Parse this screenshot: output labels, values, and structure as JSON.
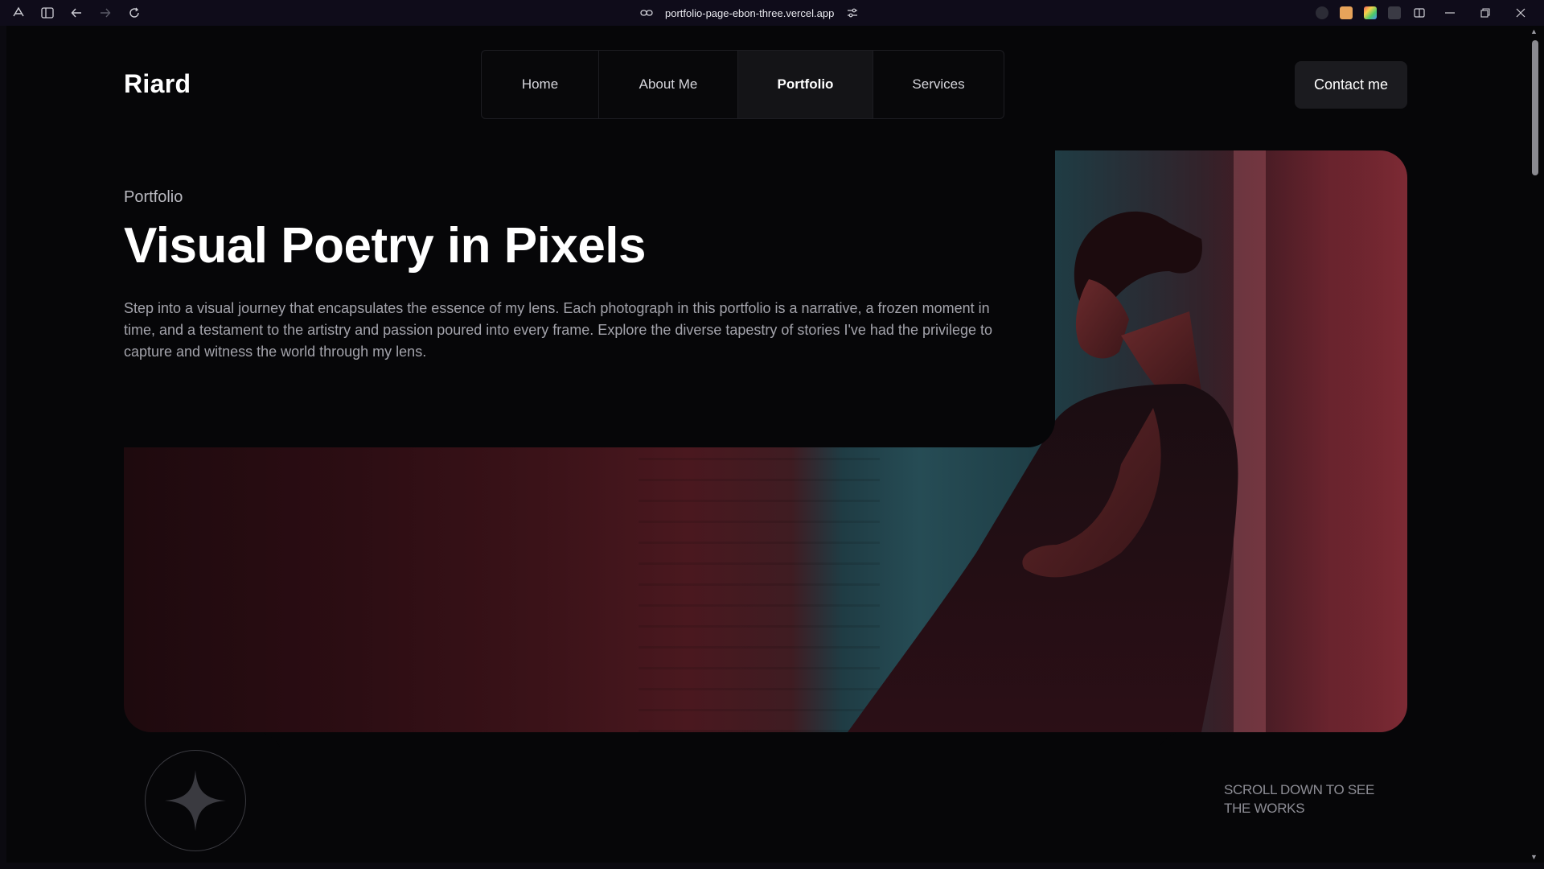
{
  "browser": {
    "url": "portfolio-page-ebon-three.vercel.app"
  },
  "site": {
    "logo": "Riard",
    "nav": [
      {
        "label": "Home"
      },
      {
        "label": "About Me"
      },
      {
        "label": "Portfolio",
        "active": true
      },
      {
        "label": "Services"
      }
    ],
    "contact_label": "Contact me"
  },
  "hero": {
    "eyebrow": "Portfolio",
    "headline": "Visual Poetry in Pixels",
    "description": "Step into a visual journey that encapsulates the essence of my lens. Each photograph in this portfolio is a narrative, a frozen moment in time, and a testament to the artistry and passion poured into every frame. Explore the diverse tapestry of stories I've had the privilege to capture and witness the world through my lens.",
    "scroll_hint": "SCROLL DOWN TO SEE THE WORKS",
    "badge_icon": "four-point-star-icon"
  },
  "colors": {
    "page_bg": "#060608",
    "button_bg": "#1b1b1f",
    "active_nav_bg": "#141417"
  }
}
